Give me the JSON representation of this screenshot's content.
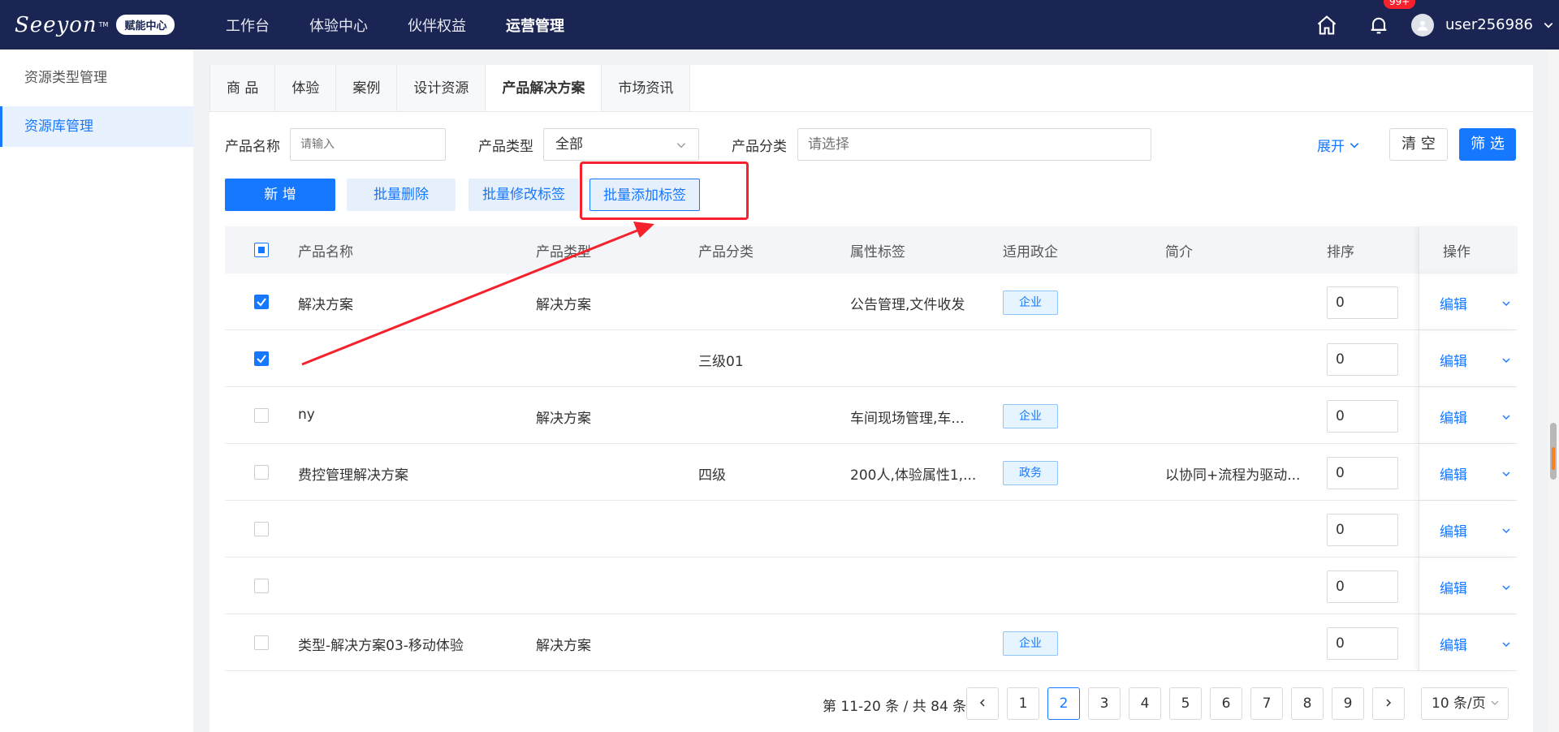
{
  "header": {
    "logo_text": "Seeyon",
    "logo_tm": "TM",
    "logo_badge": "赋能中心",
    "nav": [
      "工作台",
      "体验中心",
      "伙伴权益",
      "运营管理"
    ],
    "nav_active": 3,
    "notification_badge": "99+",
    "username": "user256986",
    "bg_color": "#1a2553"
  },
  "sidebar": {
    "items": [
      {
        "label": "资源类型管理"
      },
      {
        "label": "资源库管理"
      }
    ]
  },
  "tabs": [
    {
      "label": "商 品"
    },
    {
      "label": "体验"
    },
    {
      "label": "案例"
    },
    {
      "label": "设计资源"
    },
    {
      "label": "产品解决方案"
    },
    {
      "label": "市场资讯"
    }
  ],
  "filters": {
    "name_label": "产品名称",
    "name_placeholder": "请输入",
    "type_label": "产品类型",
    "type_value": "全部",
    "category_label": "产品分类",
    "category_placeholder": "请选择",
    "expand_label": "展开",
    "clear_label": "清 空",
    "filter_label": "筛 选"
  },
  "actions": {
    "add": "新 增",
    "batch_delete": "批量删除",
    "batch_edit_tags": "批量修改标签",
    "batch_add_tags": "批量添加标签"
  },
  "table": {
    "columns": [
      "产品名称",
      "产品类型",
      "产品分类",
      "属性标签",
      "适用政企",
      "简介",
      "排序",
      "操作"
    ],
    "rows": [
      {
        "checked": true,
        "name": "解决方案",
        "type": "解决方案",
        "category": "",
        "tags": "公告管理,文件收发",
        "scope": "企业",
        "intro": "",
        "sort": "0",
        "op": "编辑"
      },
      {
        "checked": true,
        "name": "",
        "type": "",
        "category": "三级01",
        "tags": "",
        "scope": "",
        "intro": "",
        "sort": "0",
        "op": "编辑"
      },
      {
        "checked": false,
        "name": "ny",
        "type": "解决方案",
        "category": "",
        "tags": "车间现场管理,车...",
        "scope": "企业",
        "intro": "",
        "sort": "0",
        "op": "编辑"
      },
      {
        "checked": false,
        "name": "费控管理解决方案",
        "type": "",
        "category": "四级",
        "tags": "200人,体验属性1,...",
        "scope": "政务",
        "intro": "以协同+流程为驱动...",
        "sort": "0",
        "op": "编辑"
      },
      {
        "checked": false,
        "name": "",
        "type": "",
        "category": "",
        "tags": "",
        "scope": "",
        "intro": "",
        "sort": "0",
        "op": "编辑"
      },
      {
        "checked": false,
        "name": "",
        "type": "",
        "category": "",
        "tags": "",
        "scope": "",
        "intro": "",
        "sort": "0",
        "op": "编辑"
      },
      {
        "checked": false,
        "name": "类型-解决方案03-移动体验",
        "type": "解决方案",
        "category": "",
        "tags": "",
        "scope": "企业",
        "intro": "",
        "sort": "0",
        "op": "编辑"
      }
    ]
  },
  "pagination": {
    "summary": "第 11-20 条 / 共 84 条",
    "pages": [
      "1",
      "2",
      "3",
      "4",
      "5",
      "6",
      "7",
      "8",
      "9"
    ],
    "current": "2",
    "page_size": "10 条/页"
  },
  "colors": {
    "primary": "#1677ff",
    "highlight": "#f5222d"
  }
}
